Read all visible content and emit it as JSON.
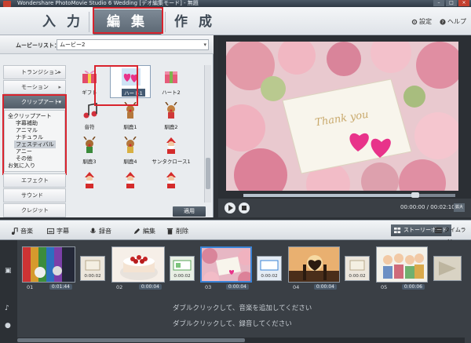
{
  "window": {
    "title": "Wondershare PhotoMovie Studio 6 Wedding [デオ編集モード] - 無題"
  },
  "nav": {
    "tabs": [
      {
        "label": "入 力"
      },
      {
        "label": "編 集"
      },
      {
        "label": "作 成"
      }
    ],
    "settings_label": "設定",
    "help_label": "ヘルプ"
  },
  "movielist": {
    "label": "ムービーリスト：",
    "value": "ムービー2"
  },
  "categories": [
    {
      "label": "トランジション"
    },
    {
      "label": "モーション"
    },
    {
      "label": "クリップアート"
    },
    {
      "label": "エフェクト"
    },
    {
      "label": "サウンド"
    },
    {
      "label": "クレジット"
    }
  ],
  "clipart_sub": {
    "items": [
      "全クリップアート",
      "字幕補助",
      "アニマル",
      "ナチュラル",
      "フェスティバル",
      "アニー",
      "その他",
      "お気に入り"
    ],
    "selected": "フェスティバル"
  },
  "clipart_items": [
    {
      "label": "ギフト"
    },
    {
      "label": "ハート1"
    },
    {
      "label": "ハート2"
    },
    {
      "label": "音符"
    },
    {
      "label": "馴鹿1"
    },
    {
      "label": "馴鹿2"
    },
    {
      "label": "馴鹿3"
    },
    {
      "label": "馴鹿4"
    },
    {
      "label": "サンタクロース1"
    },
    {
      "label": ""
    },
    {
      "label": ""
    },
    {
      "label": ""
    }
  ],
  "apply_label": "適用",
  "preview": {
    "card_text": "Thank you",
    "time_current": "00:00:00",
    "time_total": "00:02:10",
    "progress": 0.81,
    "fullscreen_label": "拡大"
  },
  "toolbar": {
    "music": "音楽",
    "subtitle": "字幕",
    "record": "録音",
    "edit": "編集",
    "delete": "削除",
    "storyboard": "ストーリーボード",
    "timeline": "タイムライン"
  },
  "clips": [
    {
      "num": "01",
      "duration": "0:01:44"
    },
    {
      "num": "02",
      "duration": "0:00:04"
    },
    {
      "num": "03",
      "duration": "0:00:04"
    },
    {
      "num": "04",
      "duration": "0:00:04"
    },
    {
      "num": "05",
      "duration": "0:00:06"
    }
  ],
  "transitions": [
    {
      "duration": "0:00:02"
    },
    {
      "duration": "0:00:02"
    },
    {
      "duration": "0:00:02"
    },
    {
      "duration": "0:00:02"
    }
  ],
  "hints": {
    "music": "ダブルクリックして、音楽を追加してください",
    "record": "ダブルクリックして、録音してください"
  },
  "colors": {
    "highlight_red": "#d9232d",
    "active_blue": "#3b84d6",
    "accent_pink": "#e8338a"
  }
}
